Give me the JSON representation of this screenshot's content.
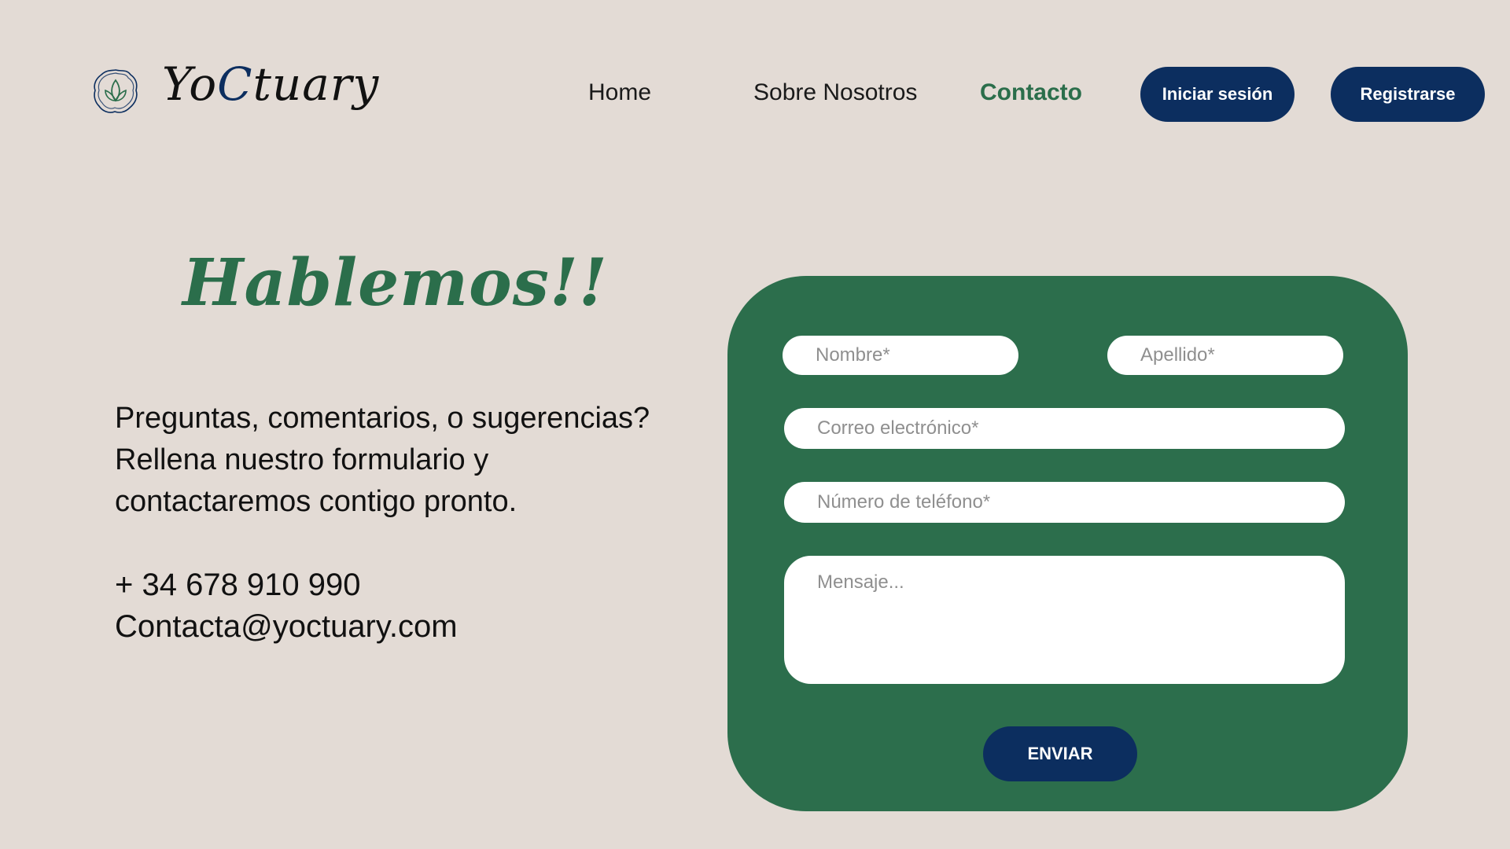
{
  "header": {
    "logo_icon": "lotus-leaf-icon",
    "brand_prefix": "Yo",
    "brand_accent": "C",
    "brand_suffix": "tuary",
    "nav": {
      "home": "Home",
      "about": "Sobre Nosotros",
      "contact": "Contacto"
    },
    "login_label": "Iniciar sesión",
    "register_label": "Registrarse"
  },
  "hero": {
    "heading": "Hablemos!!",
    "intro_lines": [
      "Preguntas, comentarios, o sugerencias?",
      "Rellena nuestro formulario y",
      "contactaremos contigo pronto."
    ],
    "phone": "+ 34 678 910 990",
    "email": "Contacta@yoctuary.com"
  },
  "form": {
    "nombre_placeholder": "Nombre*",
    "apellido_placeholder": "Apellido*",
    "email_placeholder": "Correo electrónico*",
    "phone_placeholder": "Número de teléfono*",
    "message_placeholder": "Mensaje...",
    "submit_label": "ENVIAR"
  },
  "colors": {
    "background": "#e3dbd5",
    "accent_green": "#2b6e4b",
    "navy": "#0c2e5f",
    "card_green": "#2c6e4c"
  }
}
